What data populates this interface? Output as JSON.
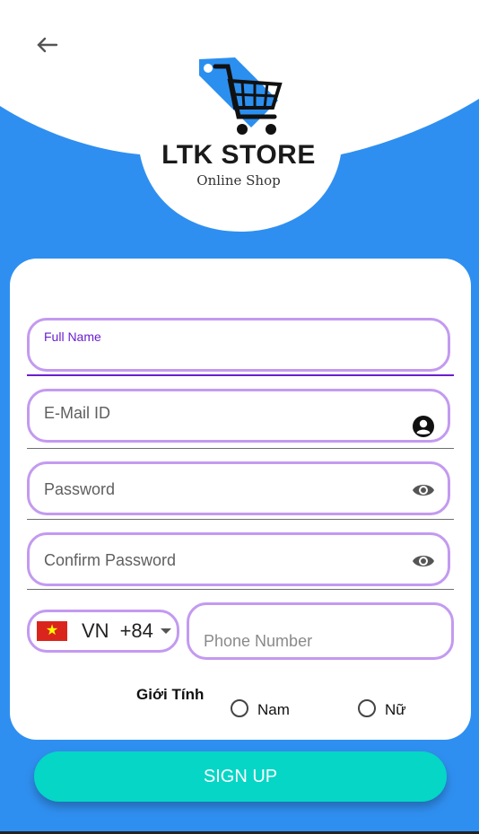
{
  "header": {
    "back_icon": "arrow-left-icon",
    "brand_title": "LTK STORE",
    "brand_subtitle": "Online Shop",
    "logo_icon": "shopping-cart-tag-icon"
  },
  "form": {
    "full_name": {
      "label": "Full Name",
      "value": ""
    },
    "email": {
      "placeholder": "E-Mail ID",
      "icon": "account-circle-icon"
    },
    "password": {
      "placeholder": "Password",
      "icon": "eye-icon"
    },
    "confirm_password": {
      "placeholder": "Confirm Password",
      "icon": "eye-icon"
    },
    "phone": {
      "country_code": "VN",
      "dial_code": "+84",
      "flag": "vietnam-flag-icon",
      "placeholder": "Phone Number"
    },
    "gender": {
      "label": "Giới Tính",
      "options": [
        "Nam",
        "Nữ"
      ],
      "selected": null
    }
  },
  "actions": {
    "signup_label": "SIGN UP"
  },
  "colors": {
    "primary_blue": "#2f8ff0",
    "field_border": "#c39af0",
    "focus_label": "#6a1ecf",
    "signup_button": "#05d6c6"
  }
}
